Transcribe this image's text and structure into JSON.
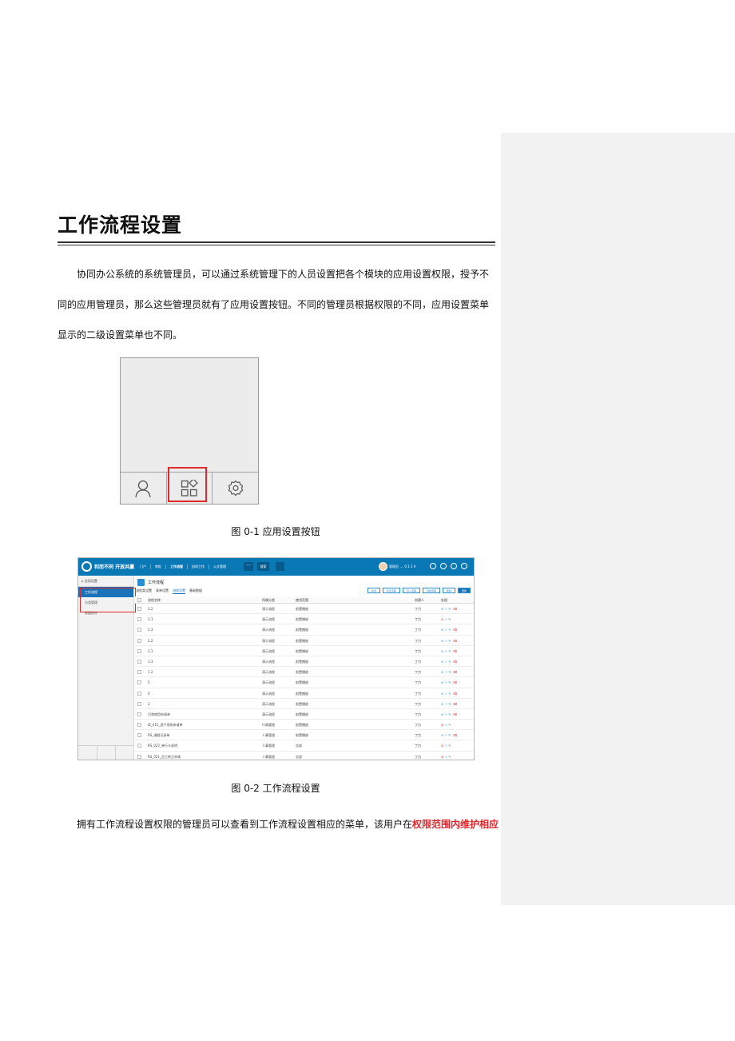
{
  "comment_pane": {
    "label": ""
  },
  "title": "工作流程设置",
  "paragraph_1": "协同办公系统的系统管理员，可以通过系统管理下的人员设置把各个模块的应用设置权限，授予不同的应用管理员，那么这些管理员就有了应用设置按钮。不同的管理员根据权限的不同，应用设置菜单显示的二级设置菜单也不同。",
  "figure_1": {
    "caption": "图 0-1   应用设置按钮",
    "dock": [
      {
        "icon": "person-icon"
      },
      {
        "icon": "apps-icon",
        "selected": true
      },
      {
        "icon": "gear-icon"
      }
    ]
  },
  "figure_2": {
    "caption": "图 0-2  工作流程设置",
    "app": {
      "logo": "和而不同 开放共赢",
      "nav": [
        "门户",
        "审批",
        "工作流程",
        "协同工作",
        "公文管理"
      ],
      "nav_active": "工作流程",
      "more": "···",
      "search_btn": "搜索",
      "user_name": "管理员",
      "counter": "0 1 2 A"
    },
    "sidebar": {
      "header": "应用设置",
      "items": [
        "工作流程",
        "分类管理",
        "数据统计"
      ],
      "active": "工作流程"
    },
    "page_title": "工作流程",
    "tabs": [
      "流程类设置",
      "表单设置",
      "流程设置",
      "基础数据"
    ],
    "tab_active": "流程设置",
    "buttons": [
      "新增",
      "导出流程",
      "导入流程",
      "复制流程",
      "删除",
      "更新"
    ],
    "columns": [
      "流程名称",
      "所属分类",
      "使用范围",
      "创建人",
      "处理"
    ],
    "rows": [
      {
        "name": "3.2",
        "cat": "演示流程",
        "scope": "前置播放",
        "creator": "丁力",
        "ops": "full"
      },
      {
        "name": "3.1",
        "cat": "演示流程",
        "scope": "前置播放",
        "creator": "丁力",
        "ops": "disabled"
      },
      {
        "name": "2.3",
        "cat": "演示流程",
        "scope": "前置播放",
        "creator": "丁力",
        "ops": "full"
      },
      {
        "name": "2.2",
        "cat": "演示流程",
        "scope": "前置播放",
        "creator": "丁力",
        "ops": "full"
      },
      {
        "name": "2.1",
        "cat": "演示流程",
        "scope": "前置播放",
        "creator": "丁力",
        "ops": "full"
      },
      {
        "name": "1.3",
        "cat": "演示流程",
        "scope": "前置播放",
        "creator": "丁力",
        "ops": "full"
      },
      {
        "name": "1.2",
        "cat": "演示流程",
        "scope": "前置播放",
        "creator": "丁力",
        "ops": "full"
      },
      {
        "name": "5",
        "cat": "演示流程",
        "scope": "前置播放",
        "creator": "丁力",
        "ops": "full"
      },
      {
        "name": "4",
        "cat": "演示流程",
        "scope": "前置播放",
        "creator": "丁力",
        "ops": "full"
      },
      {
        "name": "2",
        "cat": "演示流程",
        "scope": "前置播放",
        "creator": "丁力",
        "ops": "full"
      },
      {
        "name": "日常使用申请单",
        "cat": "演示流程",
        "scope": "前置播放",
        "creator": "丁力",
        "ops": "full"
      },
      {
        "name": "IZ_015_资产采购申请单",
        "cat": "行政管理",
        "scope": "前置播放",
        "creator": "丁力",
        "ops": "disabled"
      },
      {
        "name": "RS_请假记录单",
        "cat": "人事管理",
        "scope": "前置播放",
        "creator": "丁力",
        "ops": "full"
      },
      {
        "name": "RS_022_单行卡说明",
        "cat": "人事管理",
        "scope": "总部",
        "creator": "丁力",
        "ops": "disabled"
      },
      {
        "name": "RS_021_员工转正申请",
        "cat": "人事管理",
        "scope": "总部",
        "creator": "丁力",
        "ops": "disabled"
      }
    ]
  },
  "paragraph_2": {
    "text": "拥有工作流程设置权限的管理员可以查看到工作流程设置相应的菜单，该用户在",
    "highlight": "权限范围内维护相应",
    "highlight_color": "#e3262c"
  },
  "colors": {
    "brand": "#0b78b6",
    "accent": "#1a73b8",
    "alert": "#e02a2a"
  }
}
